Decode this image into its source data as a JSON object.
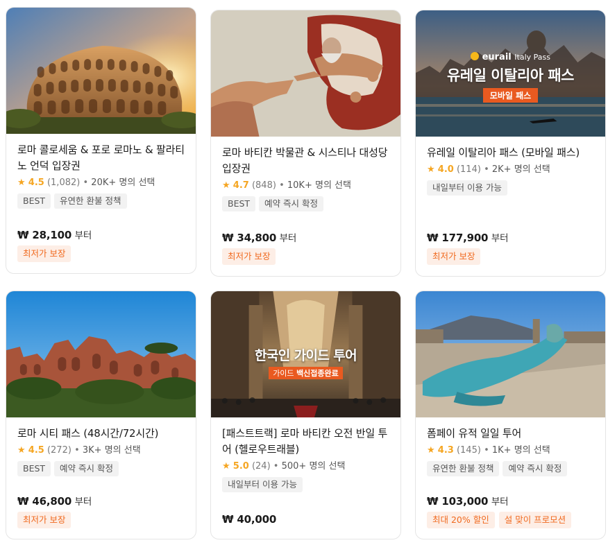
{
  "products": [
    {
      "title": "로마 콜로세움 & 포로 로마노 & 팔라티노 언덕 입장권",
      "star": "★",
      "score": "4.5",
      "reviews": "(1,082)",
      "sep": "•",
      "selections": "20K+ 명의 선택",
      "tags": [
        "BEST",
        "유연한 환불 정책"
      ],
      "price": "₩ 28,100",
      "price_suffix": "부터",
      "promos": [
        "최저가 보장"
      ]
    },
    {
      "title": "로마 바티칸 박물관 & 시스티나 대성당 입장권",
      "star": "★",
      "score": "4.7",
      "reviews": "(848)",
      "sep": "•",
      "selections": "10K+ 명의 선택",
      "tags": [
        "BEST",
        "예약 즉시 확정"
      ],
      "price": "₩ 34,800",
      "price_suffix": "부터",
      "promos": [
        "최저가 보장"
      ]
    },
    {
      "title": "유레일 이탈리아 패스 (모바일 패스)",
      "star": "★",
      "score": "4.0",
      "reviews": "(114)",
      "sep": "•",
      "selections": "2K+ 명의 선택",
      "tags": [
        "내일부터 이용 가능"
      ],
      "price": "₩ 177,900",
      "price_suffix": "부터",
      "promos": [
        "최저가 보장"
      ],
      "image_text": {
        "brand": "eurail",
        "brand_sub": "Italy Pass",
        "headline": "유레일 이탈리아 패스",
        "badge": "모바일 패스"
      }
    },
    {
      "title": "로마 시티 패스 (48시간/72시간)",
      "star": "★",
      "score": "4.5",
      "reviews": "(272)",
      "sep": "•",
      "selections": "3K+ 명의 선택",
      "tags": [
        "BEST",
        "예약 즉시 확정"
      ],
      "price": "₩ 46,800",
      "price_suffix": "부터",
      "promos": [
        "최저가 보장"
      ]
    },
    {
      "title": "[패스트트랙] 로마 바티칸 오전 반일 투어 (헬로우트래블)",
      "star": "★",
      "score": "5.0",
      "reviews": "(24)",
      "sep": "•",
      "selections": "500+ 명의 선택",
      "tags": [
        "내일부터 이용 가능"
      ],
      "price": "₩ 40,000",
      "price_suffix": "",
      "promos": [],
      "image_text": {
        "headline": "한국인 가이드 투어",
        "badge_plain": "가이드",
        "badge_bold": "백신접종완료"
      }
    },
    {
      "title": "폼페이 유적 일일 투어",
      "star": "★",
      "score": "4.3",
      "reviews": "(145)",
      "sep": "•",
      "selections": "1K+ 명의 선택",
      "tags": [
        "유연한 환불 정책",
        "예약 즉시 확정"
      ],
      "price": "₩ 103,000",
      "price_suffix": "부터",
      "promos": [
        "최대 20% 할인",
        "설 맞이 프로모션"
      ]
    }
  ]
}
